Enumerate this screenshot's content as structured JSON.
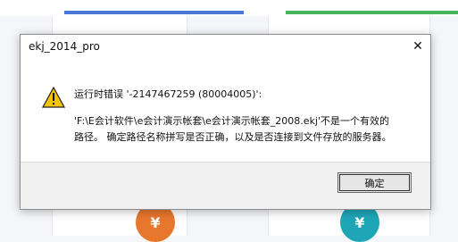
{
  "window": {
    "title": "ekj_2014_pro",
    "close_glyph": "✕"
  },
  "message": {
    "line1": "运行时错误 '-2147467259 (80004005)':",
    "body": "'F:\\E会计软件\\e会计演示帐套\\e会计演示帐套_2008.ekj'不是一个有效的路径。 确定路径名称拼写是否正确，以及是否连接到文件存放的服务器。"
  },
  "buttons": {
    "ok_label": "确定"
  },
  "icons": {
    "warning": "warning-icon",
    "close": "close-icon"
  },
  "background": {
    "accent_left": "#4a78d6",
    "accent_right": "#46b35c",
    "circle_left_glyph": "¥",
    "circle_right_glyph": "¥"
  }
}
